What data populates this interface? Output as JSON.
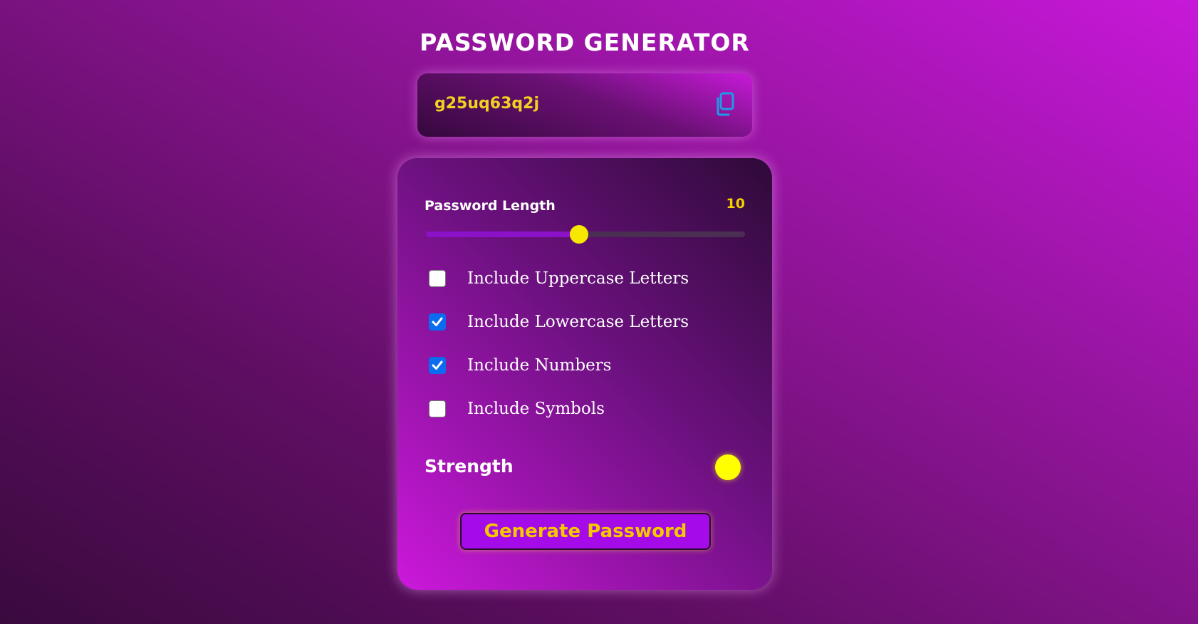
{
  "title": "PASSWORD GENERATOR",
  "password": {
    "value": "g25uq63q2j",
    "copy_icon": "copy-icon"
  },
  "length": {
    "label": "Password Length",
    "value": "10",
    "slider_fraction": 0.48
  },
  "options": [
    {
      "label": "Include Uppercase Letters",
      "checked": false
    },
    {
      "label": "Include Lowercase Letters",
      "checked": true
    },
    {
      "label": "Include Numbers",
      "checked": true
    },
    {
      "label": "Include Symbols",
      "checked": false
    }
  ],
  "strength": {
    "label": "Strength",
    "indicator_color": "#ffff00"
  },
  "generate_button": {
    "label": "Generate Password"
  },
  "colors": {
    "accent_yellow": "#f5d000",
    "checkbox_blue": "#0b6cf0",
    "button_purple": "#a40be8"
  }
}
